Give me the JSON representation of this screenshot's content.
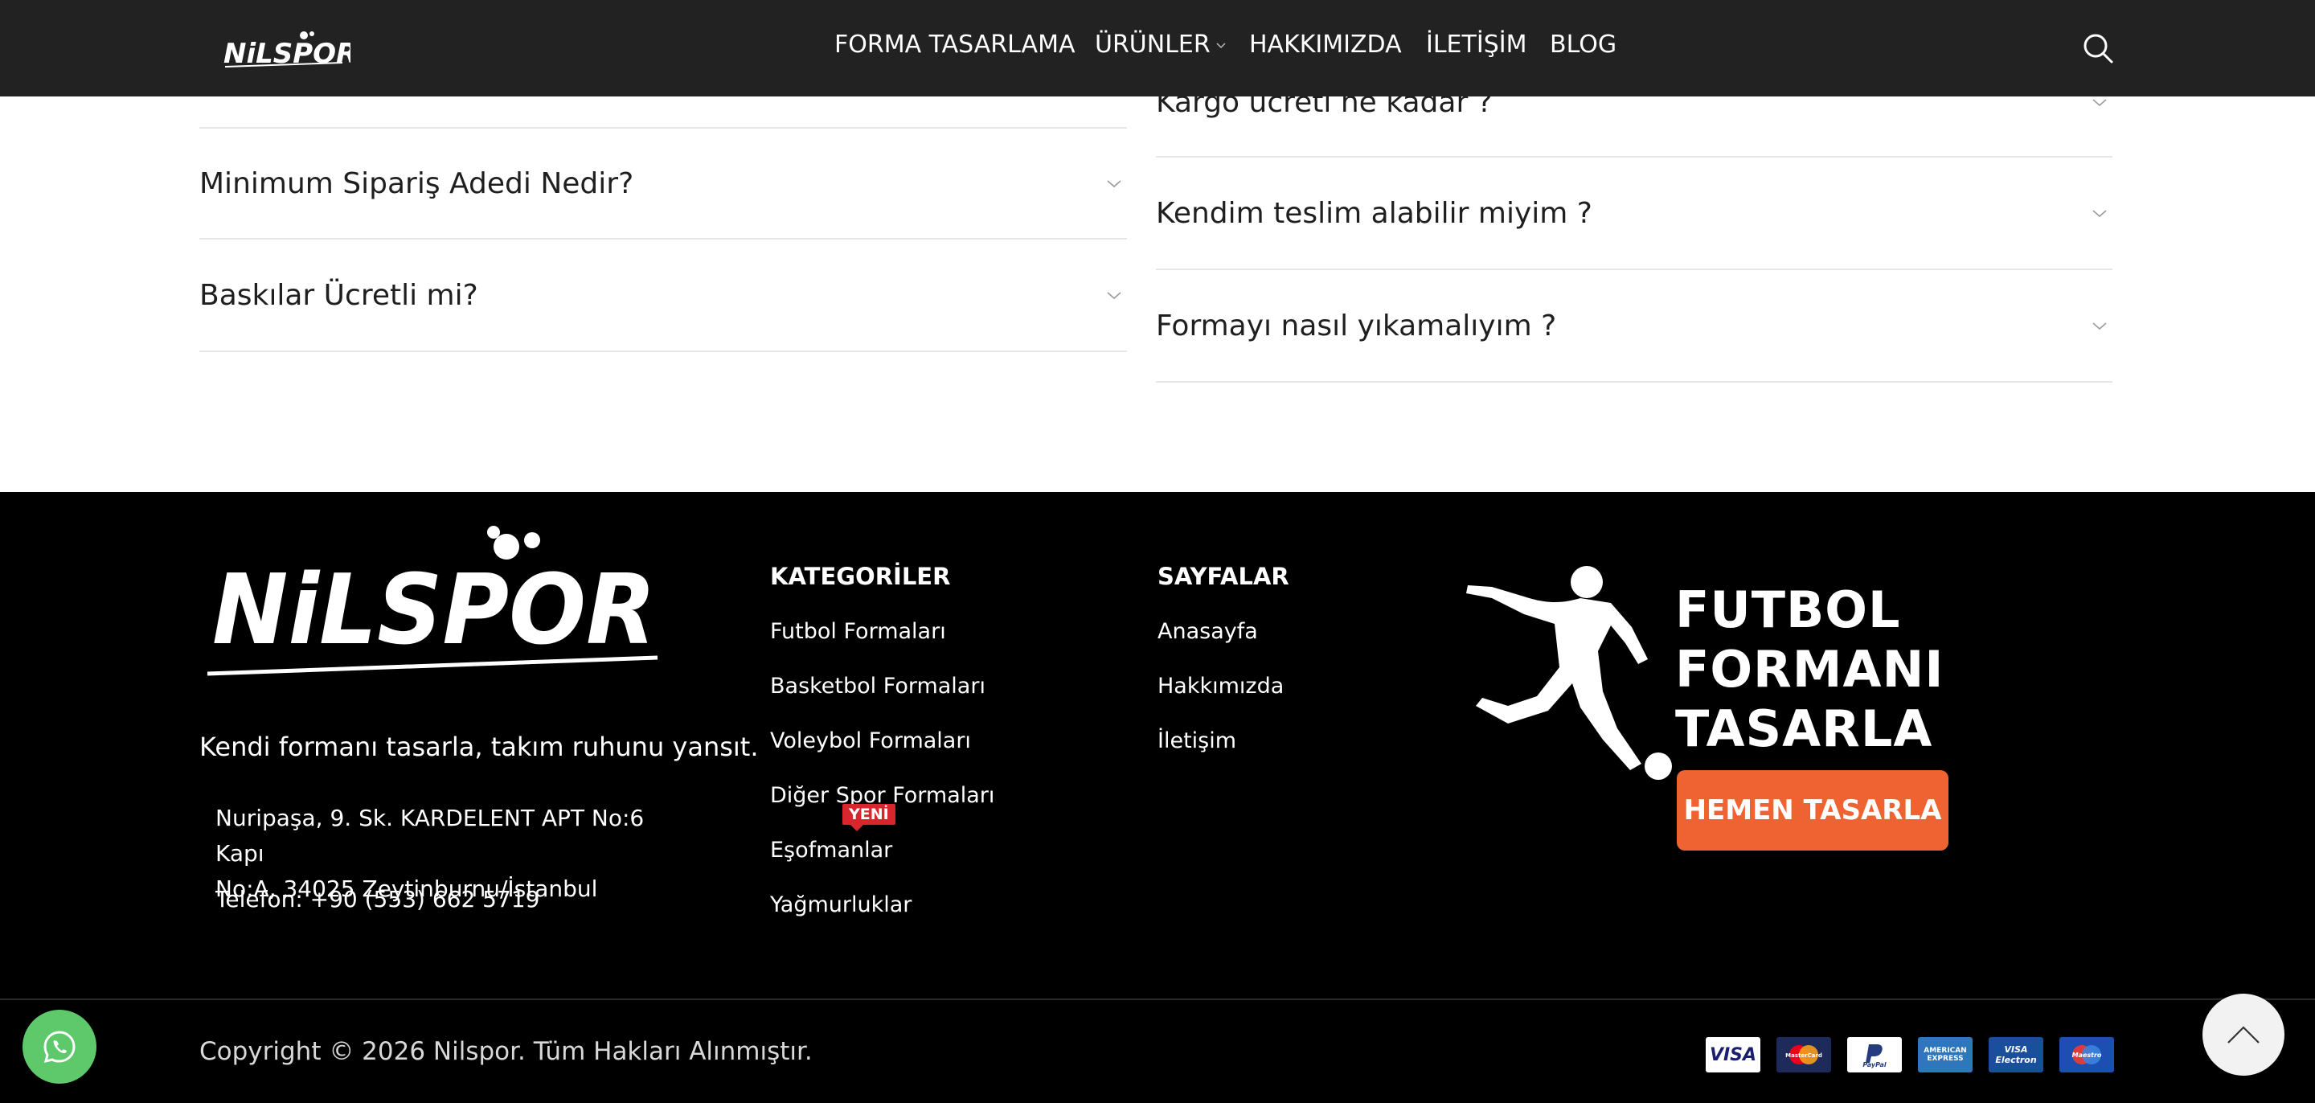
{
  "header": {
    "logo_text": "NiLSPOR",
    "nav": [
      {
        "label": "FORMA TASARLAMA"
      },
      {
        "label": "ÜRÜNLER",
        "has_dropdown": true
      },
      {
        "label": "HAKKIMIZDA"
      },
      {
        "label": "İLETİŞİM"
      },
      {
        "label": "BLOG"
      }
    ],
    "search_icon": "search-icon"
  },
  "faq": {
    "left": [
      {
        "question": "Minimum Sipariş Adedi Nedir?"
      },
      {
        "question": "Baskılar Ücretli mi?"
      }
    ],
    "right": [
      {
        "question": "Kargo ücreti ne kadar ?"
      },
      {
        "question": "Kendim teslim alabilir miyim ?"
      },
      {
        "question": "Formayı nasıl yıkamalıyım ?"
      }
    ]
  },
  "footer": {
    "logo_text": "NiLSPOR",
    "tagline": "Kendi formanı tasarla, takım ruhunu yansıt.",
    "address_line1": "Nuripaşa, 9. Sk. KARDELENT APT No:6 Kapı",
    "address_line2": "No:A, 34025 Zeytinburnu/İstanbul",
    "phone": "Telefon: +90 (553) 662 5719",
    "categories": {
      "title": "KATEGORİLER",
      "links": [
        "Futbol Formaları",
        "Basketbol Formaları",
        "Voleybol Formaları",
        "Diğer Spor Formaları",
        "Eşofmanlar",
        "Yağmurluklar"
      ],
      "new_badge": "YENİ"
    },
    "pages": {
      "title": "SAYFALAR",
      "links": [
        "Anasayfa",
        "Hakkımızda",
        "İletişim"
      ]
    },
    "promo": {
      "line1": "FUTBOL",
      "line2": "FORMANI",
      "line3": "TASARLA",
      "button": "HEMEN TASARLA"
    },
    "copyright": "Copyright © 2026 Nilspor. Tüm Hakları Alınmıştır.",
    "payments": [
      {
        "name": "VISA",
        "bg": "#ffffff",
        "fg": "#1a1f71"
      },
      {
        "name": "MasterCard",
        "bg": "#1d2a5a",
        "fg": "#ffffff"
      },
      {
        "name": "PayPal",
        "bg": "#ffffff",
        "fg": "#253b80"
      },
      {
        "name": "AMERICAN EXPRESS",
        "bg": "#2e77bc",
        "fg": "#ffffff"
      },
      {
        "name": "VISA Electron",
        "bg": "#1a4f9c",
        "fg": "#ffffff"
      },
      {
        "name": "Maestro",
        "bg": "#1d4fb3",
        "fg": "#ffffff"
      }
    ]
  },
  "colors": {
    "header_bg": "#222222",
    "footer_bg": "#000000",
    "accent_orange": "#ee6331",
    "badge_red": "#d7262d",
    "whatsapp_green": "#5dc96a"
  }
}
